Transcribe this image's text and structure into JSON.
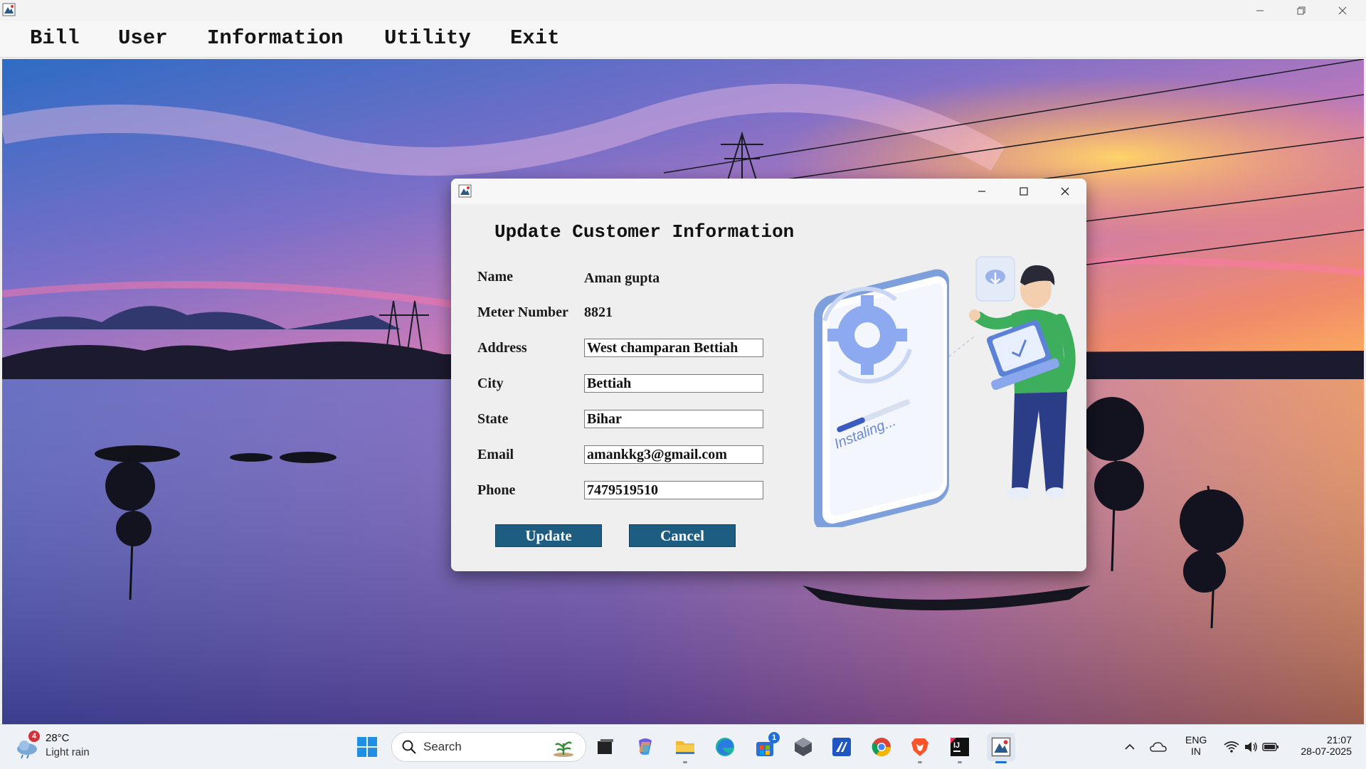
{
  "window": {
    "controls": [
      "minimize",
      "restore",
      "close"
    ]
  },
  "menu": {
    "items": [
      {
        "label": "Bill"
      },
      {
        "label": "User"
      },
      {
        "label": "Information"
      },
      {
        "label": "Utility"
      },
      {
        "label": "Exit"
      }
    ]
  },
  "dialog": {
    "heading": "Update Customer Information",
    "fields": {
      "name": {
        "label": "Name",
        "value": "Aman gupta"
      },
      "meter": {
        "label": "Meter Number",
        "value": "8821"
      },
      "address": {
        "label": "Address",
        "value": "West champaran Bettiah"
      },
      "city": {
        "label": "City",
        "value": "Bettiah"
      },
      "state": {
        "label": "State",
        "value": "Bihar"
      },
      "email": {
        "label": "Email",
        "value": "amankkg3@gmail.com"
      },
      "phone": {
        "label": "Phone",
        "value": "7479519510"
      }
    },
    "update_label": "Update",
    "cancel_label": "Cancel",
    "illustration_text": "Instaling...",
    "button_color": "#1e5d82"
  },
  "taskbar": {
    "weather": {
      "temp": "28°C",
      "condition": "Light rain",
      "badge": "4"
    },
    "search_placeholder": "Search",
    "store_badge": "1",
    "language": {
      "line1": "ENG",
      "line2": "IN"
    },
    "clock": {
      "time": "21:07",
      "date": "28-07-2025"
    },
    "apps": [
      "start-icon",
      "search-icon",
      "task-view-icon",
      "copilot-icon",
      "file-explorer-icon",
      "edge-icon",
      "store-icon",
      "app-icon",
      "visual-studio-icon",
      "chrome-icon",
      "brave-icon",
      "intellij-icon",
      "java-app-icon"
    ]
  }
}
